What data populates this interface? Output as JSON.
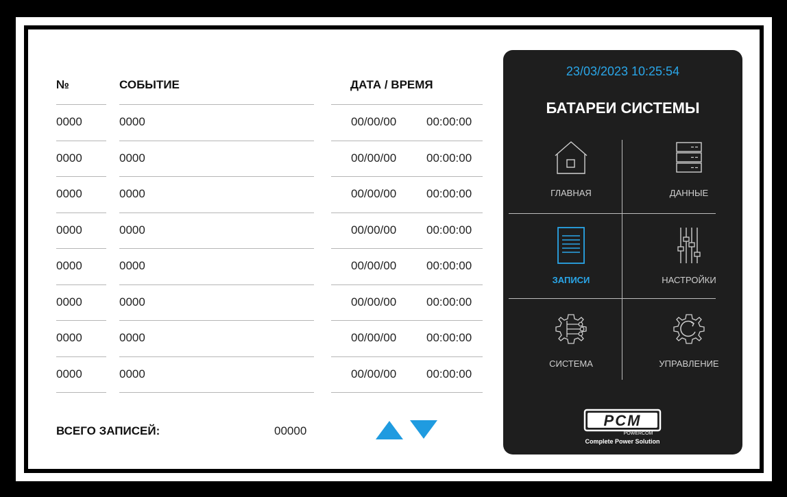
{
  "header": {
    "number": "№",
    "event": "СОБЫТИЕ",
    "datetime": "ДАТА / ВРЕМЯ"
  },
  "rows": [
    {
      "no": "0000",
      "event": "0000",
      "date": "00/00/00",
      "time": "00:00:00"
    },
    {
      "no": "0000",
      "event": "0000",
      "date": "00/00/00",
      "time": "00:00:00"
    },
    {
      "no": "0000",
      "event": "0000",
      "date": "00/00/00",
      "time": "00:00:00"
    },
    {
      "no": "0000",
      "event": "0000",
      "date": "00/00/00",
      "time": "00:00:00"
    },
    {
      "no": "0000",
      "event": "0000",
      "date": "00/00/00",
      "time": "00:00:00"
    },
    {
      "no": "0000",
      "event": "0000",
      "date": "00/00/00",
      "time": "00:00:00"
    },
    {
      "no": "0000",
      "event": "0000",
      "date": "00/00/00",
      "time": "00:00:00"
    },
    {
      "no": "0000",
      "event": "0000",
      "date": "00/00/00",
      "time": "00:00:00"
    }
  ],
  "footer": {
    "total_label": "ВСЕГО ЗАПИСЕЙ:",
    "total_value": "00000"
  },
  "panel": {
    "datetime": "23/03/2023 10:25:54",
    "title": "БАТАРЕИ СИСТЕМЫ",
    "menu": [
      {
        "label": "ГЛАВНАЯ",
        "icon": "home-icon",
        "active": false
      },
      {
        "label": "ДАННЫЕ",
        "icon": "server-icon",
        "active": false
      },
      {
        "label": "ЗАПИСИ",
        "icon": "document-icon",
        "active": true
      },
      {
        "label": "НАСТРОЙКИ",
        "icon": "sliders-icon",
        "active": false
      },
      {
        "label": "СИСТЕМА",
        "icon": "system-gear-icon",
        "active": false
      },
      {
        "label": "УПРАВЛЕНИЕ",
        "icon": "control-gear-icon",
        "active": false
      }
    ],
    "logo": {
      "brand": "PCM",
      "sub": "POWERCOM",
      "tagline": "Complete Power Solution"
    }
  },
  "colors": {
    "accent": "#2aa6e8",
    "panel_bg": "#1e1e1e",
    "arrow": "#1f9be0"
  }
}
